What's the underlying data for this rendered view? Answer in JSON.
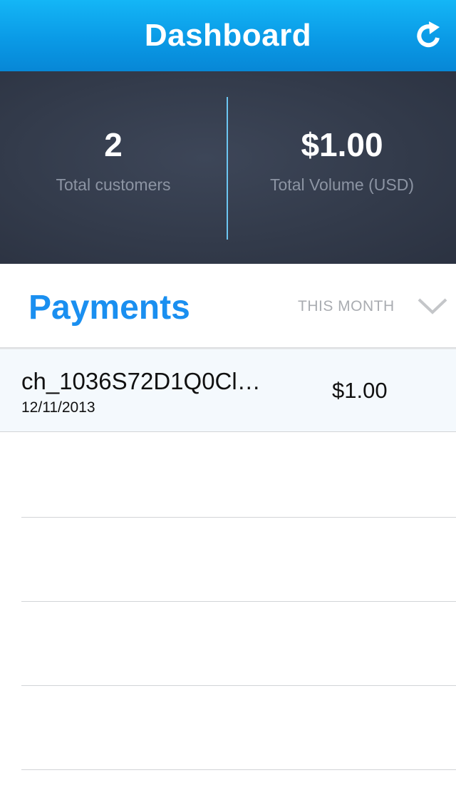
{
  "navbar": {
    "title": "Dashboard",
    "refresh_icon": "refresh-icon"
  },
  "stats": {
    "customers": {
      "value": "2",
      "label": "Total customers"
    },
    "volume": {
      "value": "$1.00",
      "label": "Total Volume (USD)"
    }
  },
  "payments": {
    "title": "Payments",
    "period": "THIS MONTH",
    "period_icon": "chevron-down-icon",
    "items": [
      {
        "id": "ch_1036S72D1Q0Cl…",
        "date": "12/11/2013",
        "amount": "$1.00"
      }
    ]
  },
  "colors": {
    "navbar": "#0a9ae6",
    "stats_bg": "#333b4b",
    "accent": "#1a8ff0",
    "divider": "#6cc6f2",
    "row_highlight": "#f4f9fd"
  }
}
